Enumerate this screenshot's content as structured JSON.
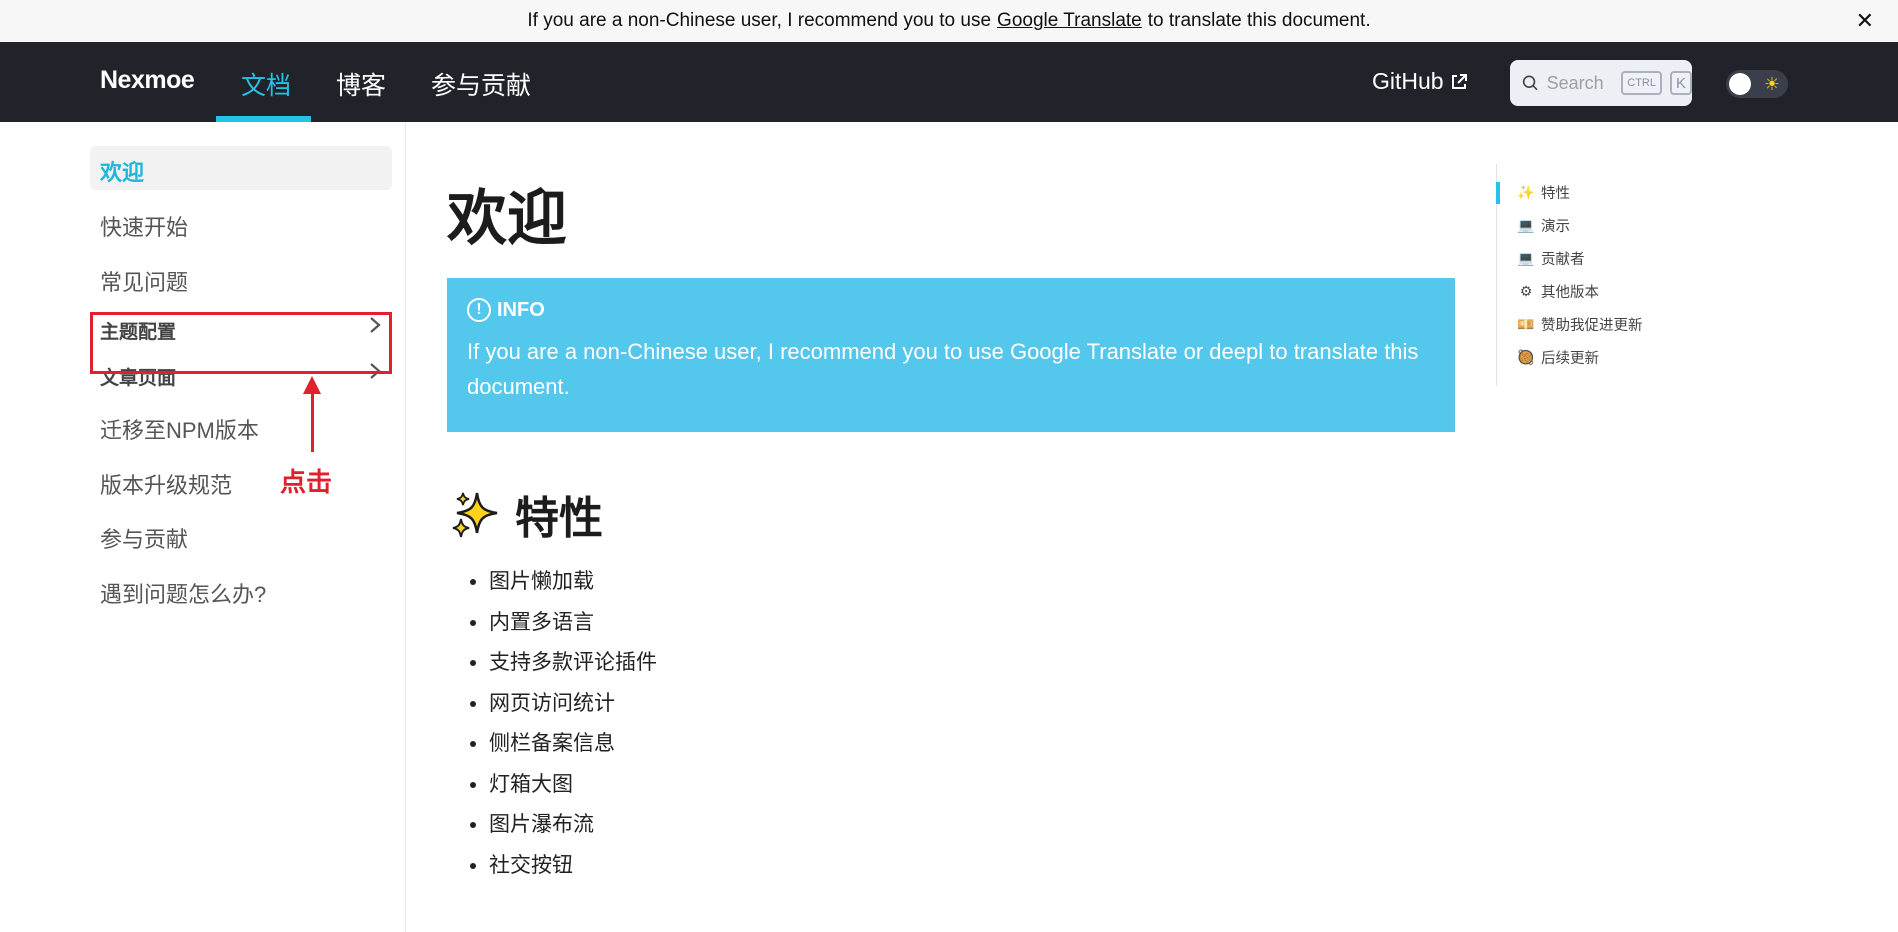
{
  "banner": {
    "text_before": "If you are a non-Chinese user, I recommend you to use",
    "link": "Google Translate",
    "text_after": "to translate this document.",
    "close": "✕"
  },
  "navbar": {
    "logo": "Nexmoe",
    "links": [
      "文档",
      "博客",
      "参与贡献"
    ],
    "github": "GitHub",
    "search_placeholder": "Search",
    "kbd_ctrl": "CTRL",
    "kbd_k": "K",
    "accent": "#25c2e7"
  },
  "sidebar": {
    "items": [
      "欢迎",
      "快速开始",
      "常见问题",
      "主题配置",
      "文章页面",
      "迁移至NPM版本",
      "版本升级规范",
      "参与贡献",
      "遇到问题怎么办?"
    ],
    "annotation": "点击"
  },
  "main": {
    "title": "欢迎",
    "admonition": {
      "label": "INFO",
      "text": "If you are a non-Chinese user, I recommend you to use Google Translate or deepl to translate this document."
    },
    "section_title": "特性",
    "features": [
      "图片懒加载",
      "内置多语言",
      "支持多款评论插件",
      "网页访问统计",
      "侧栏备案信息",
      "灯箱大图",
      "图片瀑布流",
      "社交按钮"
    ]
  },
  "toc": {
    "items": [
      {
        "icon": "✨",
        "label": "特性"
      },
      {
        "icon": "💻",
        "label": "演示"
      },
      {
        "icon": "💻",
        "label": "贡献者"
      },
      {
        "icon": "⚙",
        "label": "其他版本"
      },
      {
        "icon": "💴",
        "label": "赞助我促进更新"
      },
      {
        "icon": "🥘",
        "label": "后续更新"
      }
    ]
  }
}
